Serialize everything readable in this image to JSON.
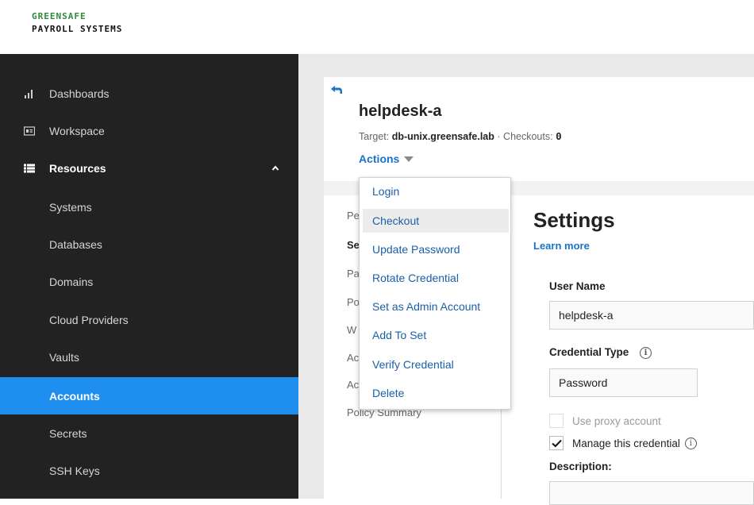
{
  "brand": {
    "line1": "GREENSAFE",
    "line2": "PAYROLL SYSTEMS"
  },
  "sidebar": {
    "top_items": [
      {
        "label": "Dashboards",
        "icon": "bar-chart-icon"
      },
      {
        "label": "Workspace",
        "icon": "workspace-icon"
      }
    ],
    "group": {
      "label": "Resources",
      "icon": "list-icon",
      "expanded": true
    },
    "sub_items": [
      {
        "label": "Systems",
        "active": false
      },
      {
        "label": "Databases",
        "active": false
      },
      {
        "label": "Domains",
        "active": false
      },
      {
        "label": "Cloud Providers",
        "active": false
      },
      {
        "label": "Vaults",
        "active": false
      },
      {
        "label": "Accounts",
        "active": true
      },
      {
        "label": "Secrets",
        "active": false
      },
      {
        "label": "SSH Keys",
        "active": false
      }
    ]
  },
  "account": {
    "name": "helpdesk-a",
    "target_label": "Target:",
    "target_value": "db-unix.greensafe.lab",
    "separator": "·",
    "checkouts_label": "Checkouts:",
    "checkouts_value": "0",
    "actions_label": "Actions"
  },
  "actions_menu": {
    "items": [
      "Login",
      "Checkout",
      "Update Password",
      "Rotate Credential",
      "Set as Admin Account",
      "Add To Set",
      "Verify Credential",
      "Delete"
    ],
    "hovered": "Checkout"
  },
  "left_tabs": [
    "Pe",
    "Se",
    "Pa",
    "Po",
    "W",
    "Ac",
    "Ac",
    "Policy Summary"
  ],
  "settings": {
    "title": "Settings",
    "learn_more": "Learn more",
    "user_name_label": "User Name",
    "user_name_value": "helpdesk-a",
    "credential_type_label": "Credential Type",
    "credential_type_value": "Password",
    "use_proxy_label": "Use proxy account",
    "manage_label": "Manage this credential",
    "description_label": "Description:",
    "info_glyph": "i"
  },
  "colors": {
    "sidebar_bg": "#222222",
    "active": "#1e8fef",
    "link": "#1a73c9",
    "brand_green": "#2e8b3c"
  }
}
